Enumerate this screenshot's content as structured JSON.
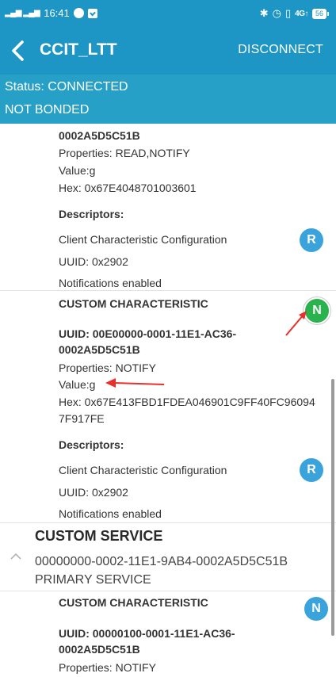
{
  "statusbar": {
    "left_signal": "ᴳᴸᴸ ⁴ᴳ",
    "time": "16:41",
    "network": "4G↑",
    "battery": "56"
  },
  "appbar": {
    "title": "CCIT_LTT",
    "disconnect_label": "DISCONNECT"
  },
  "connection": {
    "status": "Status: CONNECTED",
    "bond": "NOT BONDED"
  },
  "characteristic_1": {
    "uuid_tail": "0002A5D5C51B",
    "properties": "Properties: READ,NOTIFY",
    "value": "Value:g",
    "hex": "Hex: 0x67E4048701003601",
    "descriptors_label": "Descriptors:",
    "descriptor": {
      "name": "Client Characteristic Configuration",
      "uuid": "UUID: 0x2902",
      "note": "Notifications enabled",
      "badge": "R"
    }
  },
  "characteristic_2": {
    "title": "CUSTOM CHARACTERISTIC",
    "badge": "N",
    "uuid_line1": "UUID: 00E00000-0001-11E1-AC36-",
    "uuid_line2": "0002A5D5C51B",
    "properties": "Properties: NOTIFY",
    "value": "Value:g",
    "hex_line1": "Hex: 0x67E413FBD1FDEA046901C9FF40FC96094",
    "hex_line2": "7F917FE",
    "descriptors_label": "Descriptors:",
    "descriptor": {
      "name": "Client Characteristic Configuration",
      "uuid": "UUID: 0x2902",
      "note": "Notifications enabled",
      "badge": "R"
    }
  },
  "service": {
    "title": "CUSTOM SERVICE",
    "uuid": "00000000-0002-11E1-9AB4-0002A5D5C51B",
    "type": "PRIMARY SERVICE"
  },
  "characteristic_3": {
    "title": "CUSTOM CHARACTERISTIC",
    "badge": "N",
    "uuid_line1": "UUID: 00000100-0001-11E1-AC36-",
    "uuid_line2": "0002A5D5C51B",
    "properties": "Properties: NOTIFY"
  },
  "colors": {
    "app_bar": "#1d96c6",
    "status_area": "#27a0c8",
    "badge_blue": "#3aa3dc",
    "badge_green": "#2ab24d",
    "annotation_arrow": "#e8302a"
  },
  "icons": [
    "back-arrow-icon",
    "chevron-up-icon",
    "bluetooth-icon",
    "alarm-icon",
    "vibrate-icon",
    "battery-icon",
    "chat-icon",
    "check-square-icon"
  ]
}
